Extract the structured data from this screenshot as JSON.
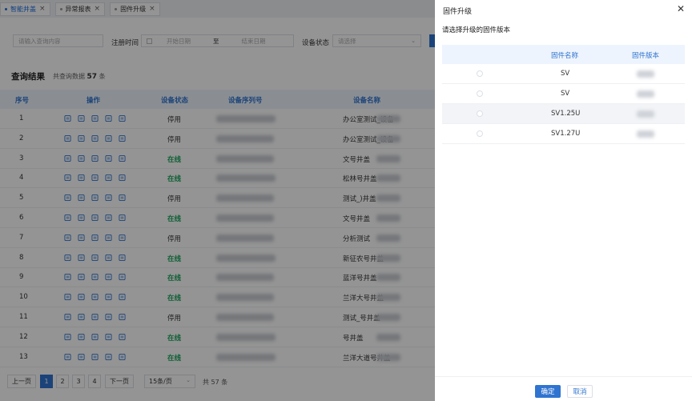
{
  "tabs": [
    {
      "label": "智能井盖",
      "active": true
    },
    {
      "label": "异常报表",
      "active": false
    },
    {
      "label": "固件升级",
      "active": false
    }
  ],
  "filter": {
    "search_placeholder": "请输入查询内容",
    "reg_time_label": "注册时间",
    "start_placeholder": "开始日期",
    "to_label": "至",
    "end_placeholder": "结束日期",
    "status_label": "设备状态",
    "status_placeholder": "请选择"
  },
  "results": {
    "title": "查询结果",
    "count_prefix": "共查询数据",
    "count": "57",
    "count_suffix": "条"
  },
  "table": {
    "headers": [
      "序号",
      "操作",
      "设备状态",
      "设备序列号",
      "设备名称"
    ],
    "rows": [
      {
        "no": "1",
        "status": "停用",
        "online": false,
        "name": "办公室测试_设备"
      },
      {
        "no": "2",
        "status": "停用",
        "online": false,
        "name": "办公室测试_设备"
      },
      {
        "no": "3",
        "status": "在线",
        "online": true,
        "name": "文号井盖"
      },
      {
        "no": "4",
        "status": "在线",
        "online": true,
        "name": "松林号井盖"
      },
      {
        "no": "5",
        "status": "停用",
        "online": false,
        "name": "测试_)井盖"
      },
      {
        "no": "6",
        "status": "在线",
        "online": true,
        "name": "文号井盖"
      },
      {
        "no": "7",
        "status": "停用",
        "online": false,
        "name": "分析测试"
      },
      {
        "no": "8",
        "status": "在线",
        "online": true,
        "name": "新征农号井盖"
      },
      {
        "no": "9",
        "status": "在线",
        "online": true,
        "name": "蓝洋号井盖"
      },
      {
        "no": "10",
        "status": "在线",
        "online": true,
        "name": "兰洋大号井盖"
      },
      {
        "no": "11",
        "status": "停用",
        "online": false,
        "name": "测试_号井盖"
      },
      {
        "no": "12",
        "status": "在线",
        "online": true,
        "name": "号井盖"
      },
      {
        "no": "13",
        "status": "在线",
        "online": true,
        "name": "兰洋大道号井盖"
      }
    ]
  },
  "pager": {
    "prev": "上一页",
    "pages": [
      "1",
      "2",
      "3",
      "4"
    ],
    "next": "下一页",
    "size": "15条/页",
    "total": "共 57 条"
  },
  "drawer": {
    "title": "固件升级",
    "subtitle": "请选择升级的固件版本",
    "col_name": "固件名称",
    "col_version": "固件版本",
    "rows": [
      {
        "name": "SV",
        "version": ""
      },
      {
        "name": "SV",
        "version": ""
      },
      {
        "name": "SV1.25U",
        "version": ""
      },
      {
        "name": "SV1.27U",
        "version": ""
      }
    ],
    "ok": "确定",
    "cancel": "取消"
  },
  "colors": {
    "accent": "#2f74d0",
    "online": "#19a55a"
  }
}
